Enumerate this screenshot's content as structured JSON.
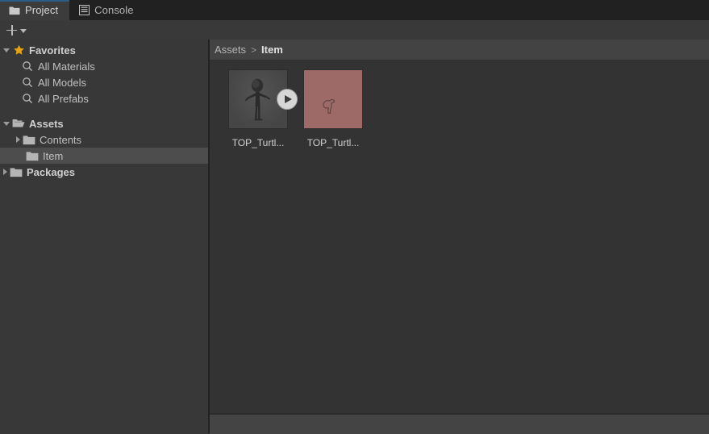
{
  "window": {
    "tabs": [
      {
        "label": "Project",
        "icon": "folder-icon",
        "active": true
      },
      {
        "label": "Console",
        "icon": "list-lines-icon",
        "active": false
      }
    ]
  },
  "toolbar": {
    "create_label": "",
    "add_icon": "plus-icon",
    "dropdown_icon": "chevron-down-icon"
  },
  "sidebar": {
    "favorites": {
      "label": "Favorites",
      "icon": "star-icon",
      "expanded": true,
      "items": [
        {
          "label": "All Materials",
          "icon": "search-icon"
        },
        {
          "label": "All Models",
          "icon": "search-icon"
        },
        {
          "label": "All Prefabs",
          "icon": "search-icon"
        }
      ]
    },
    "assets": {
      "label": "Assets",
      "icon": "folder-open-icon",
      "expanded": true,
      "items": [
        {
          "label": "Contents",
          "icon": "folder-icon",
          "expanded": false,
          "selected": false
        },
        {
          "label": "Item",
          "icon": "folder-icon",
          "expanded": false,
          "selected": true
        }
      ]
    },
    "packages": {
      "label": "Packages",
      "icon": "folder-icon",
      "expanded": false
    }
  },
  "main": {
    "breadcrumb": {
      "root": "Assets",
      "separator": ">",
      "current": "Item"
    },
    "assets": [
      {
        "label": "TOP_Turtl...",
        "kind": "model",
        "icon": "model-thumbnail",
        "has_play_badge": true,
        "play_icon": "play-icon",
        "bg_color": "#4c4c4c"
      },
      {
        "label": "TOP_Turtl...",
        "kind": "material",
        "icon": "material-thumbnail",
        "has_play_badge": false,
        "bg_color": "#9d6a68"
      }
    ]
  },
  "colors": {
    "accent": "#2c5d87",
    "panel_bg": "#383838",
    "grid_bg": "#333333",
    "selection": "#4d4d4d",
    "star": "#e3a317",
    "folder": "#b5b5b5"
  }
}
